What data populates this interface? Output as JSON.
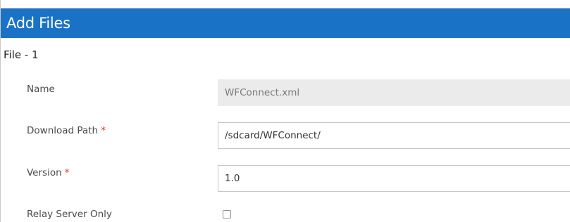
{
  "dialog": {
    "title": "Add Files"
  },
  "file": {
    "section_title": "File - 1",
    "fields": {
      "name": {
        "label": "Name",
        "value": "WFConnect.xml"
      },
      "download_path": {
        "label": "Download Path",
        "required_marker": "*",
        "value": "/sdcard/WFConnect/"
      },
      "version": {
        "label": "Version",
        "required_marker": "*",
        "value": "1.0"
      },
      "relay_server_only": {
        "label": "Relay Server Only",
        "checked": false
      }
    }
  },
  "colors": {
    "header_bg": "#1a72c6",
    "required": "#e0322f",
    "readonly_bg": "#ebebeb"
  }
}
